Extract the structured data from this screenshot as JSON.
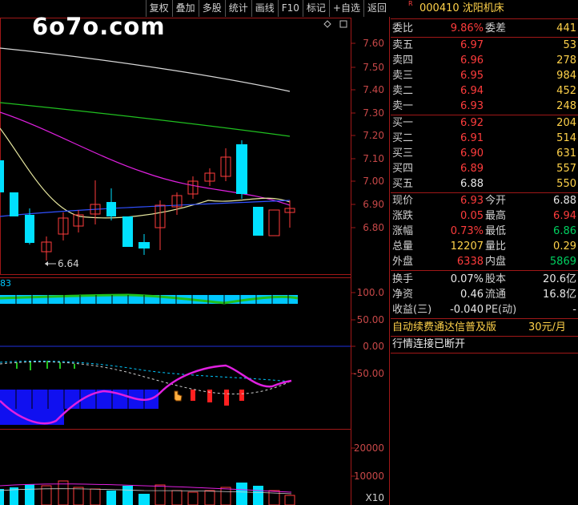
{
  "toolbar": {
    "buttons": [
      "复权",
      "叠加",
      "多股",
      "统计",
      "画线",
      "F10",
      "标记",
      "+自选",
      "返回"
    ]
  },
  "logo": "6o7o.com",
  "price_axis": [
    "7.60",
    "7.50",
    "7.40",
    "7.30",
    "7.20",
    "7.10",
    "7.00",
    "6.90",
    "6.80"
  ],
  "low_marker": "6.64",
  "ind1": {
    "label": "83",
    "axis": [
      "100.0",
      "50.00",
      "0.00",
      "-50.00"
    ]
  },
  "vol": {
    "axis": [
      "20000",
      "10000"
    ],
    "unit": "X10"
  },
  "stock": {
    "code": "000410",
    "name": "沈阳机床",
    "flag": "R"
  },
  "weibi": {
    "l1": "委比",
    "v1": "9.86%",
    "l2": "委差",
    "v2": "441"
  },
  "sells": [
    {
      "label": "卖五",
      "price": "6.97",
      "vol": "53"
    },
    {
      "label": "卖四",
      "price": "6.96",
      "vol": "278"
    },
    {
      "label": "卖三",
      "price": "6.95",
      "vol": "984"
    },
    {
      "label": "卖二",
      "price": "6.94",
      "vol": "452"
    },
    {
      "label": "卖一",
      "price": "6.93",
      "vol": "248"
    }
  ],
  "buys": [
    {
      "label": "买一",
      "price": "6.92",
      "vol": "204"
    },
    {
      "label": "买二",
      "price": "6.91",
      "vol": "514"
    },
    {
      "label": "买三",
      "price": "6.90",
      "vol": "631"
    },
    {
      "label": "买四",
      "price": "6.89",
      "vol": "557"
    },
    {
      "label": "买五",
      "price": "6.88",
      "vol": "550"
    }
  ],
  "quote": [
    {
      "l1": "现价",
      "v1": "6.93",
      "l2": "今开",
      "v2": "6.88"
    },
    {
      "l1": "涨跌",
      "v1": "0.05",
      "l2": "最高",
      "v2": "6.94"
    },
    {
      "l1": "涨幅",
      "v1": "0.73%",
      "l2": "最低",
      "v2": "6.86"
    },
    {
      "l1": "总量",
      "v1": "12207",
      "l2": "量比",
      "v2": "0.29"
    },
    {
      "l1": "外盘",
      "v1": "6338",
      "l2": "内盘",
      "v2": "5869"
    }
  ],
  "fund": [
    {
      "l1": "换手",
      "v1": "0.07%",
      "l2": "股本",
      "v2": "20.6亿"
    },
    {
      "l1": "净资",
      "v1": "0.46",
      "l2": "流通",
      "v2": "16.8亿"
    },
    {
      "l1": "收益(三)",
      "v1": "-0.040",
      "l2": "PE(动)",
      "v2": "-"
    }
  ],
  "ad": {
    "text": "自动续费通达信普及版",
    "price": "30元/月"
  },
  "status": "行情连接已断开"
}
